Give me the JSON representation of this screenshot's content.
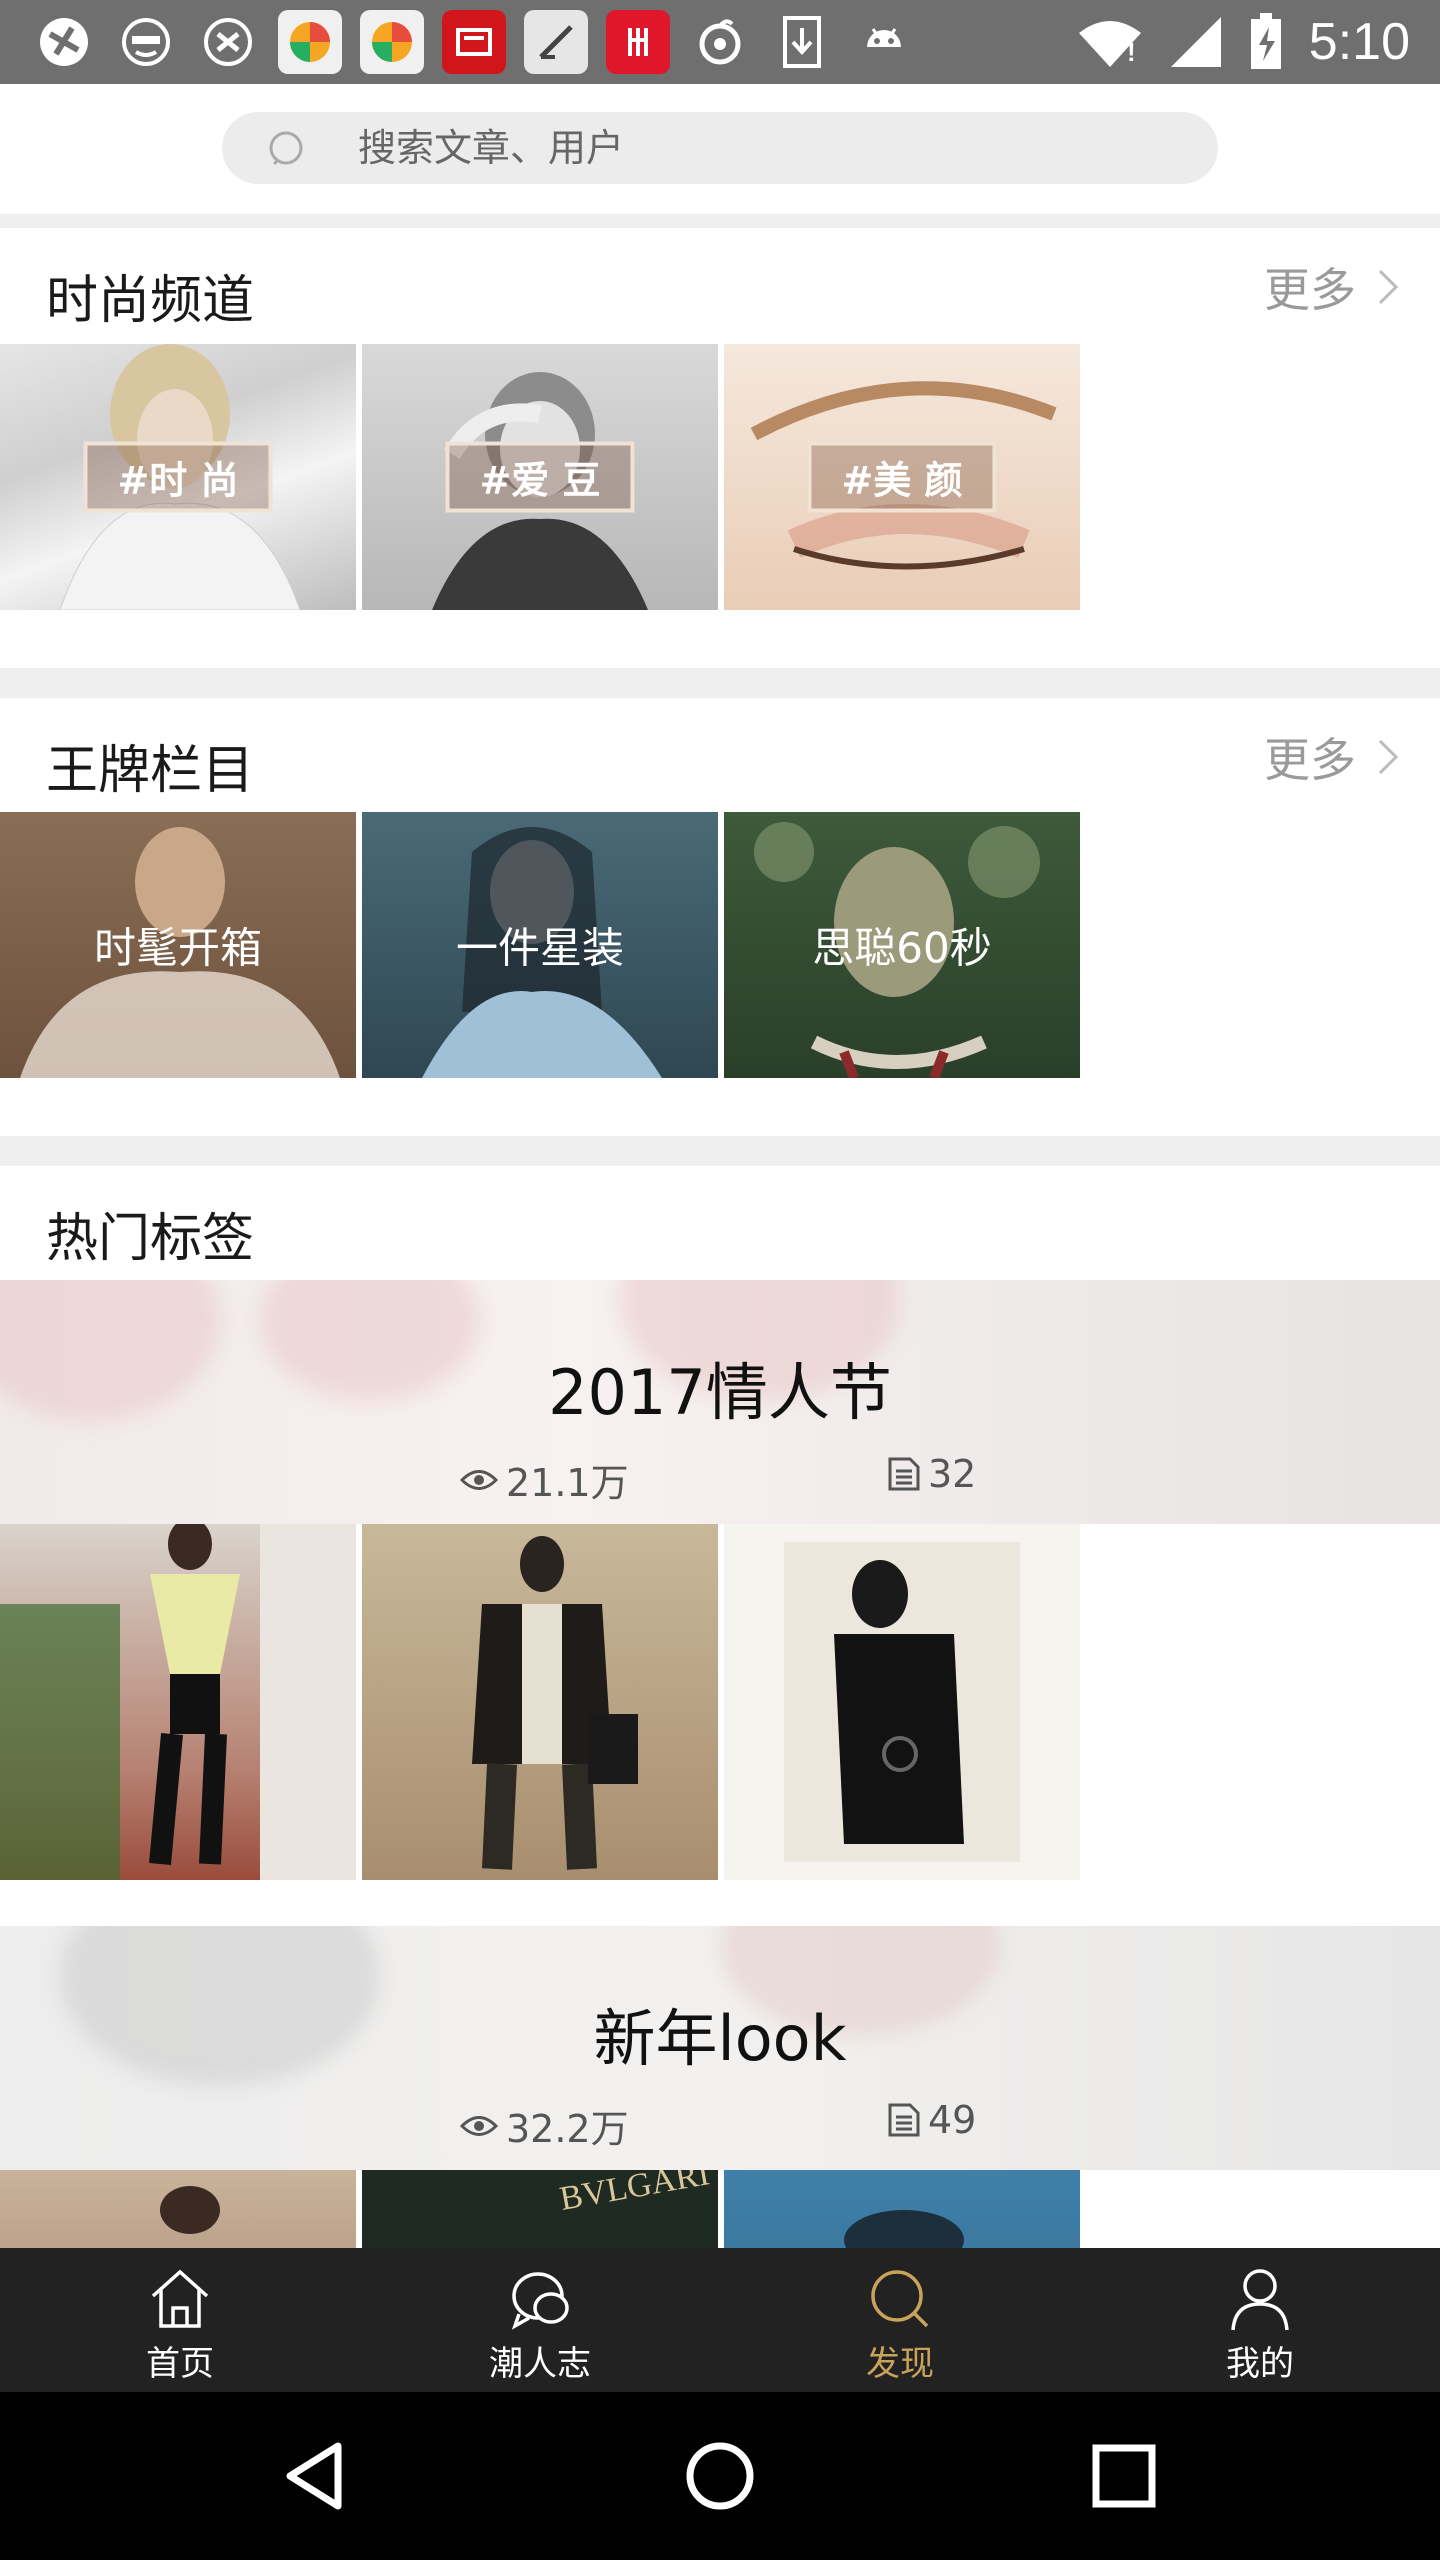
{
  "status_bar": {
    "time": "5:10",
    "notification_icons": [
      "browser-icon",
      "face-icon",
      "bow-icon",
      "app-store-icon",
      "app-store-icon",
      "zhidian-icon",
      "edit-icon",
      "food-icon",
      "music-icon",
      "download-icon",
      "android-icon"
    ],
    "indicators": [
      "wifi-icon",
      "signal-icon",
      "battery-charging-icon"
    ]
  },
  "search": {
    "placeholder": "搜索文章、用户"
  },
  "fashion_channel": {
    "title": "时尚频道",
    "more_label": "更多",
    "tiles": [
      {
        "tag": "#时 尚"
      },
      {
        "tag": "#爱 豆"
      },
      {
        "tag": "#美 颜"
      }
    ]
  },
  "ace_columns": {
    "title": "王牌栏目",
    "more_label": "更多",
    "tiles": [
      {
        "caption": "时髦开箱"
      },
      {
        "caption": "一件星装"
      },
      {
        "caption": "思聪60秒"
      }
    ]
  },
  "hot_tags": {
    "title": "热门标签",
    "cards": [
      {
        "title": "2017情人节",
        "views": "21.1万",
        "posts": "32"
      },
      {
        "title": "新年look",
        "views": "32.2万",
        "posts": "49"
      }
    ]
  },
  "tab_bar": {
    "items": [
      {
        "label": "首页",
        "icon": "home-icon"
      },
      {
        "label": "潮人志",
        "icon": "chat-icon"
      },
      {
        "label": "发现",
        "icon": "discover-icon",
        "active": true
      },
      {
        "label": "我的",
        "icon": "profile-icon"
      }
    ],
    "active_color": "#c9a35b"
  },
  "nav_bar": {
    "buttons": [
      "back-icon",
      "home-circle-icon",
      "recents-icon"
    ]
  }
}
